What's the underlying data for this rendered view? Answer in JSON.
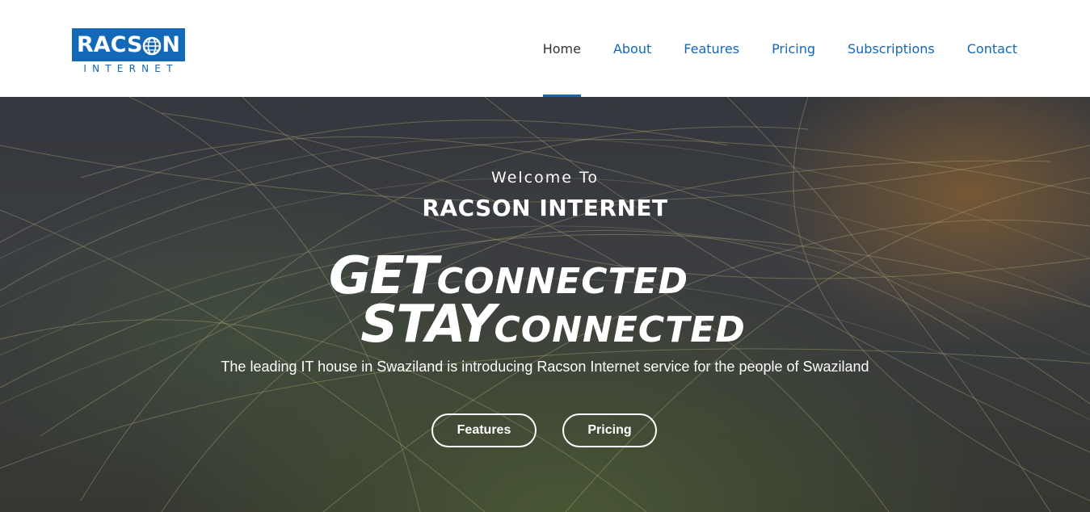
{
  "logo": {
    "top_text": "RACSON",
    "bottom_text": "INTERNET"
  },
  "nav": {
    "items": [
      {
        "label": "Home",
        "active": true
      },
      {
        "label": "About"
      },
      {
        "label": "Features"
      },
      {
        "label": "Pricing"
      },
      {
        "label": "Subscriptions"
      },
      {
        "label": "Contact"
      }
    ]
  },
  "hero": {
    "welcome": "Welcome To",
    "brand": "RACSON INTERNET",
    "slogan_line1_big": "GET",
    "slogan_line1_small": "connected",
    "slogan_line2_big": "STAY",
    "slogan_line2_small": "connected",
    "tagline": "The leading IT house in Swaziland is introducing Racson Internet service for the people of Swaziland",
    "buttons": {
      "features": "Features",
      "pricing": "Pricing"
    }
  },
  "colors": {
    "brand_blue": "#1468b8",
    "nav_active": "#333333"
  }
}
